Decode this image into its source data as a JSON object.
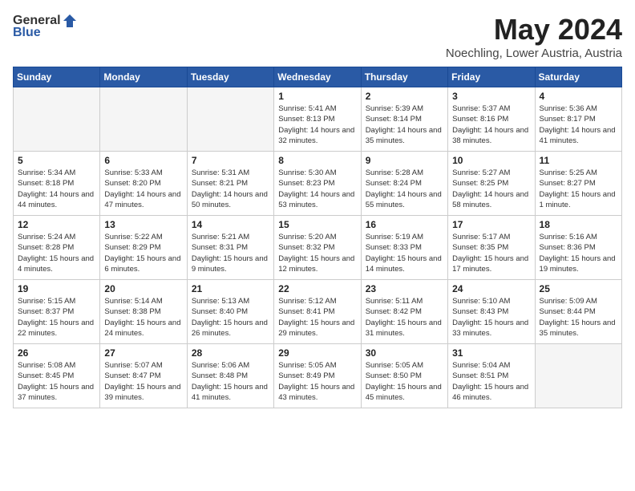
{
  "header": {
    "logo_general": "General",
    "logo_blue": "Blue",
    "month": "May 2024",
    "location": "Noechling, Lower Austria, Austria"
  },
  "weekdays": [
    "Sunday",
    "Monday",
    "Tuesday",
    "Wednesday",
    "Thursday",
    "Friday",
    "Saturday"
  ],
  "weeks": [
    [
      {
        "day": "",
        "info": "",
        "empty": true
      },
      {
        "day": "",
        "info": "",
        "empty": true
      },
      {
        "day": "",
        "info": "",
        "empty": true
      },
      {
        "day": "1",
        "info": "Sunrise: 5:41 AM\nSunset: 8:13 PM\nDaylight: 14 hours\nand 32 minutes.",
        "empty": false
      },
      {
        "day": "2",
        "info": "Sunrise: 5:39 AM\nSunset: 8:14 PM\nDaylight: 14 hours\nand 35 minutes.",
        "empty": false
      },
      {
        "day": "3",
        "info": "Sunrise: 5:37 AM\nSunset: 8:16 PM\nDaylight: 14 hours\nand 38 minutes.",
        "empty": false
      },
      {
        "day": "4",
        "info": "Sunrise: 5:36 AM\nSunset: 8:17 PM\nDaylight: 14 hours\nand 41 minutes.",
        "empty": false
      }
    ],
    [
      {
        "day": "5",
        "info": "Sunrise: 5:34 AM\nSunset: 8:18 PM\nDaylight: 14 hours\nand 44 minutes.",
        "empty": false
      },
      {
        "day": "6",
        "info": "Sunrise: 5:33 AM\nSunset: 8:20 PM\nDaylight: 14 hours\nand 47 minutes.",
        "empty": false
      },
      {
        "day": "7",
        "info": "Sunrise: 5:31 AM\nSunset: 8:21 PM\nDaylight: 14 hours\nand 50 minutes.",
        "empty": false
      },
      {
        "day": "8",
        "info": "Sunrise: 5:30 AM\nSunset: 8:23 PM\nDaylight: 14 hours\nand 53 minutes.",
        "empty": false
      },
      {
        "day": "9",
        "info": "Sunrise: 5:28 AM\nSunset: 8:24 PM\nDaylight: 14 hours\nand 55 minutes.",
        "empty": false
      },
      {
        "day": "10",
        "info": "Sunrise: 5:27 AM\nSunset: 8:25 PM\nDaylight: 14 hours\nand 58 minutes.",
        "empty": false
      },
      {
        "day": "11",
        "info": "Sunrise: 5:25 AM\nSunset: 8:27 PM\nDaylight: 15 hours\nand 1 minute.",
        "empty": false
      }
    ],
    [
      {
        "day": "12",
        "info": "Sunrise: 5:24 AM\nSunset: 8:28 PM\nDaylight: 15 hours\nand 4 minutes.",
        "empty": false
      },
      {
        "day": "13",
        "info": "Sunrise: 5:22 AM\nSunset: 8:29 PM\nDaylight: 15 hours\nand 6 minutes.",
        "empty": false
      },
      {
        "day": "14",
        "info": "Sunrise: 5:21 AM\nSunset: 8:31 PM\nDaylight: 15 hours\nand 9 minutes.",
        "empty": false
      },
      {
        "day": "15",
        "info": "Sunrise: 5:20 AM\nSunset: 8:32 PM\nDaylight: 15 hours\nand 12 minutes.",
        "empty": false
      },
      {
        "day": "16",
        "info": "Sunrise: 5:19 AM\nSunset: 8:33 PM\nDaylight: 15 hours\nand 14 minutes.",
        "empty": false
      },
      {
        "day": "17",
        "info": "Sunrise: 5:17 AM\nSunset: 8:35 PM\nDaylight: 15 hours\nand 17 minutes.",
        "empty": false
      },
      {
        "day": "18",
        "info": "Sunrise: 5:16 AM\nSunset: 8:36 PM\nDaylight: 15 hours\nand 19 minutes.",
        "empty": false
      }
    ],
    [
      {
        "day": "19",
        "info": "Sunrise: 5:15 AM\nSunset: 8:37 PM\nDaylight: 15 hours\nand 22 minutes.",
        "empty": false
      },
      {
        "day": "20",
        "info": "Sunrise: 5:14 AM\nSunset: 8:38 PM\nDaylight: 15 hours\nand 24 minutes.",
        "empty": false
      },
      {
        "day": "21",
        "info": "Sunrise: 5:13 AM\nSunset: 8:40 PM\nDaylight: 15 hours\nand 26 minutes.",
        "empty": false
      },
      {
        "day": "22",
        "info": "Sunrise: 5:12 AM\nSunset: 8:41 PM\nDaylight: 15 hours\nand 29 minutes.",
        "empty": false
      },
      {
        "day": "23",
        "info": "Sunrise: 5:11 AM\nSunset: 8:42 PM\nDaylight: 15 hours\nand 31 minutes.",
        "empty": false
      },
      {
        "day": "24",
        "info": "Sunrise: 5:10 AM\nSunset: 8:43 PM\nDaylight: 15 hours\nand 33 minutes.",
        "empty": false
      },
      {
        "day": "25",
        "info": "Sunrise: 5:09 AM\nSunset: 8:44 PM\nDaylight: 15 hours\nand 35 minutes.",
        "empty": false
      }
    ],
    [
      {
        "day": "26",
        "info": "Sunrise: 5:08 AM\nSunset: 8:45 PM\nDaylight: 15 hours\nand 37 minutes.",
        "empty": false
      },
      {
        "day": "27",
        "info": "Sunrise: 5:07 AM\nSunset: 8:47 PM\nDaylight: 15 hours\nand 39 minutes.",
        "empty": false
      },
      {
        "day": "28",
        "info": "Sunrise: 5:06 AM\nSunset: 8:48 PM\nDaylight: 15 hours\nand 41 minutes.",
        "empty": false
      },
      {
        "day": "29",
        "info": "Sunrise: 5:05 AM\nSunset: 8:49 PM\nDaylight: 15 hours\nand 43 minutes.",
        "empty": false
      },
      {
        "day": "30",
        "info": "Sunrise: 5:05 AM\nSunset: 8:50 PM\nDaylight: 15 hours\nand 45 minutes.",
        "empty": false
      },
      {
        "day": "31",
        "info": "Sunrise: 5:04 AM\nSunset: 8:51 PM\nDaylight: 15 hours\nand 46 minutes.",
        "empty": false
      },
      {
        "day": "",
        "info": "",
        "empty": true
      }
    ]
  ]
}
